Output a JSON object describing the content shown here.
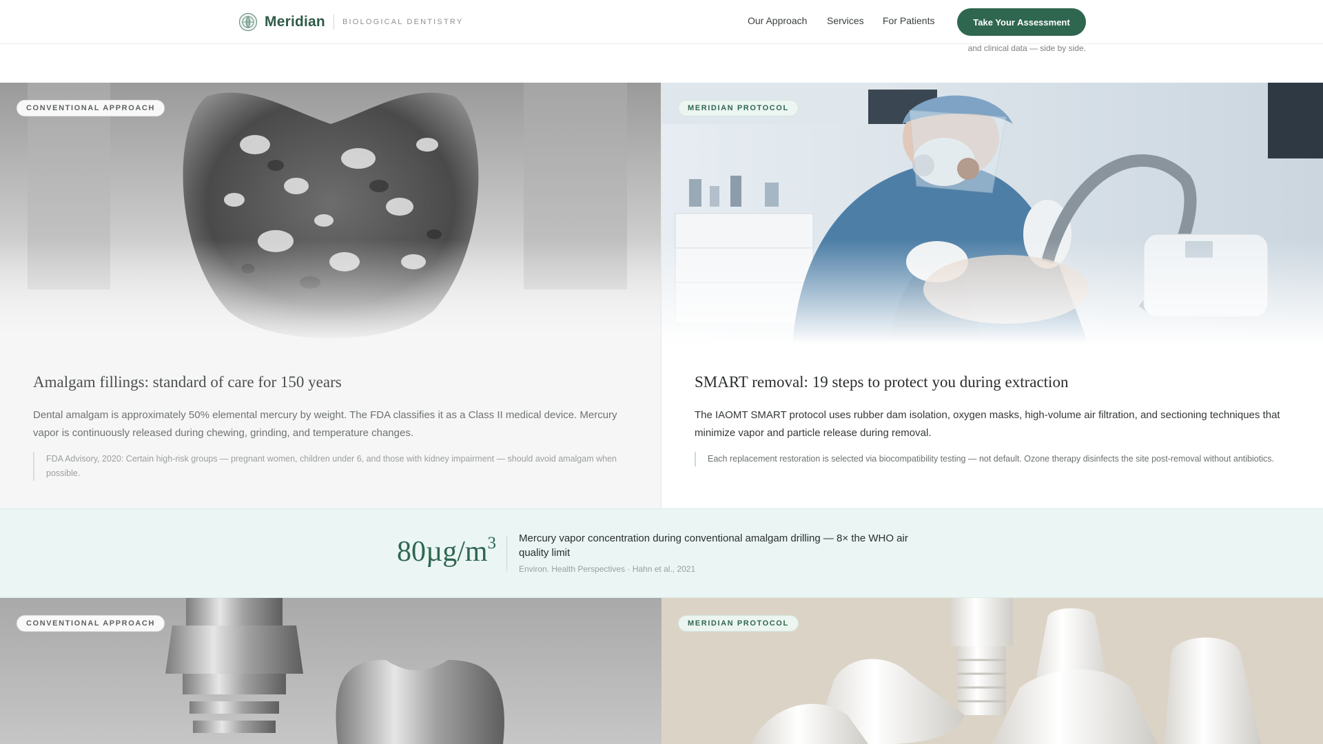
{
  "header": {
    "brand_name": "Meridian",
    "brand_tagline": "BIOLOGICAL DENTISTRY",
    "nav": [
      "Our Approach",
      "Services",
      "For Patients"
    ],
    "cta_label": "Take Your Assessment",
    "subhead_fragment": "and clinical data — side by side."
  },
  "comparison": [
    {
      "badge": "CONVENTIONAL APPROACH",
      "image": "amalgam-filling-closeup",
      "title": "Amalgam fillings: standard of care for 150 years",
      "body": "Dental amalgam is approximately 50% elemental mercury by weight. The FDA classifies it as a Class II medical device. Mercury vapor is continuously released during chewing, grinding, and temperature changes.",
      "note": "FDA Advisory, 2020: Certain high-risk groups — pregnant women, children under 6, and those with kidney impairment — should avoid amalgam when possible."
    },
    {
      "badge": "MERIDIAN PROTOCOL",
      "image": "dentist-in-protective-mask-performing-removal",
      "title": "SMART removal: 19 steps to protect you during extraction",
      "body": "The IAOMT SMART protocol uses rubber dam isolation, oxygen masks, high-volume air filtration, and sectioning techniques that minimize vapor and particle release during removal.",
      "note": "Each replacement restoration is selected via biocompatibility testing — not default. Ozone therapy disinfects the site post-removal without antibiotics."
    }
  ],
  "stat": {
    "value": "80µg/m",
    "value_sup": "3",
    "description": "Mercury vapor concentration during conventional amalgam drilling — 8× the WHO air quality limit",
    "source": "Environ. Health Perspectives · Hahn et al., 2021"
  },
  "second_row": [
    {
      "badge": "CONVENTIONAL APPROACH",
      "image": "titanium-implant-and-metal-crown"
    },
    {
      "badge": "MERIDIAN PROTOCOL",
      "image": "white-ceramic-implants-and-crowns"
    }
  ],
  "colors": {
    "brand_green": "#2f6650",
    "stat_band": "#eaf5f4",
    "badge_green_bg": "#ecf6f1"
  }
}
